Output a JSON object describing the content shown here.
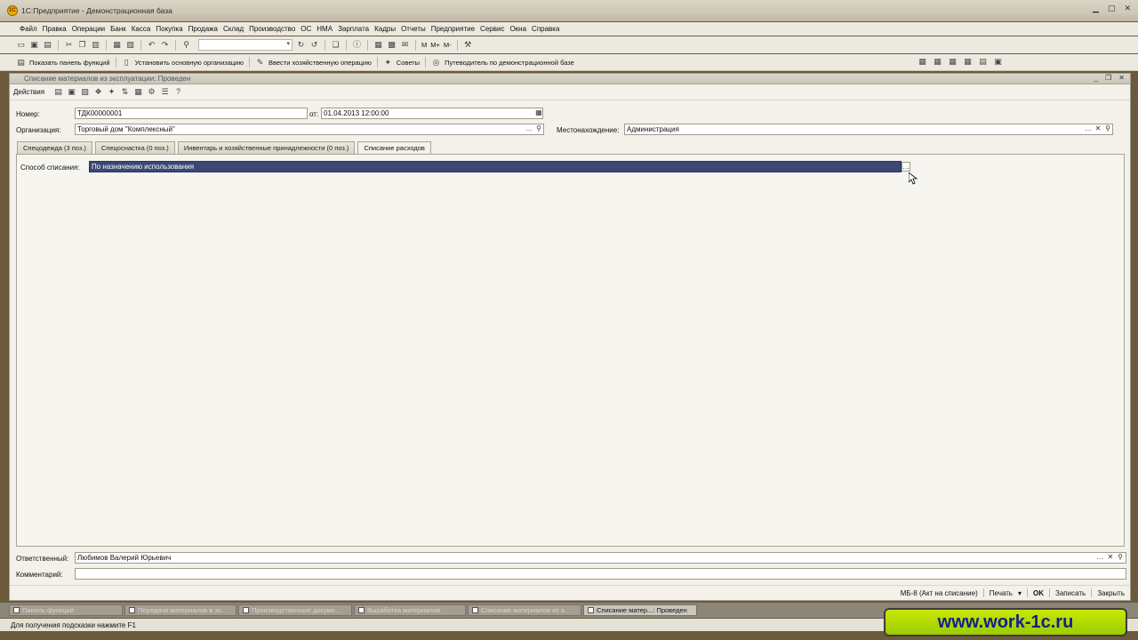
{
  "window": {
    "title": "1С:Предприятие - Демонстрационная база"
  },
  "menu": [
    "Файл",
    "Правка",
    "Операции",
    "Банк",
    "Касса",
    "Покупка",
    "Продажа",
    "Склад",
    "Производство",
    "ОС",
    "НМА",
    "Зарплата",
    "Кадры",
    "Отчеты",
    "Предприятие",
    "Сервис",
    "Окна",
    "Справка"
  ],
  "toolbar2": {
    "show_panel": "Показать панель функций",
    "set_org": "Установить основную организацию",
    "enter_op": "Ввести хозяйственную операцию",
    "tips": "Советы",
    "guide": "Путеводитель по демонстрационной базе"
  },
  "toolbar_letters": {
    "m": "M",
    "mplus": "M+",
    "mminus": "M-"
  },
  "document": {
    "title": "Списание материалов из эксплуатации: Проведен",
    "actions_label": "Действия",
    "number_label": "Номер:",
    "number_value": "ТДК00000001",
    "date_label": "от:",
    "date_value": "01.04.2013 12:00:00",
    "org_label": "Организация:",
    "org_value": "Торговый дом \"Комплексный\"",
    "location_label": "Местонахождение:",
    "location_value": "Администрация",
    "tabs": [
      "Спецодежда (3 поз.)",
      "Спецоснастка (0 поз.)",
      "Инвентарь и хозяйственные принадлежности (0 поз.)",
      "Списание расходов"
    ],
    "method_label": "Способ списания:",
    "method_value": "По назначению использования",
    "responsible_label": "Ответственный:",
    "responsible_value": "Любимов Валерий Юрьевич",
    "comment_label": "Комментарий:",
    "comment_value": "",
    "bottom": {
      "mb8": "МБ-8 (Акт на списание)",
      "print": "Печать",
      "ok": "OK",
      "save": "Записать",
      "close": "Закрыть"
    }
  },
  "taskbar": [
    {
      "label": "Панель функций",
      "active": false
    },
    {
      "label": "Передача материалов в эк...",
      "active": false
    },
    {
      "label": "Производственные докуме...",
      "active": false
    },
    {
      "label": "Выработка материалов",
      "active": false
    },
    {
      "label": "Списание материалов из э...",
      "active": false
    },
    {
      "label": "Списание матер...: Проведен",
      "active": true
    }
  ],
  "status": "Для получения подсказки нажмите F1",
  "watermark": "www.work-1c.ru"
}
